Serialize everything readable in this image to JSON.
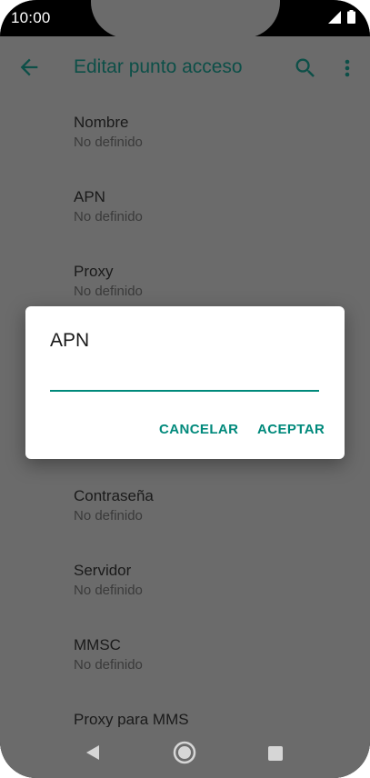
{
  "status_bar": {
    "time": "10:00",
    "icons": [
      "signal-icon",
      "battery-icon"
    ]
  },
  "app_bar": {
    "title": "Editar punto acceso",
    "icons": [
      "back-arrow-icon",
      "search-icon",
      "more-vert-icon"
    ]
  },
  "list": {
    "items": [
      {
        "title": "Nombre",
        "summary": "No definido"
      },
      {
        "title": "APN",
        "summary": "No definido"
      },
      {
        "title": "Proxy",
        "summary": "No definido"
      },
      {
        "title": "Contraseña",
        "summary": "No definido"
      },
      {
        "title": "Servidor",
        "summary": "No definido"
      },
      {
        "title": "MMSC",
        "summary": "No definido"
      },
      {
        "title": "Proxy para MMS",
        "summary": ""
      }
    ]
  },
  "dialog": {
    "title": "APN",
    "input_value": "",
    "cancel_label": "CANCELAR",
    "ok_label": "ACEPTAR"
  },
  "nav_bar": {
    "icons": [
      "back-triangle-icon",
      "home-circle-icon",
      "recents-square-icon"
    ]
  },
  "colors": {
    "scrim_background": "#6b6b6b",
    "accent": "#00897b",
    "title_text": "#0d4f48"
  }
}
